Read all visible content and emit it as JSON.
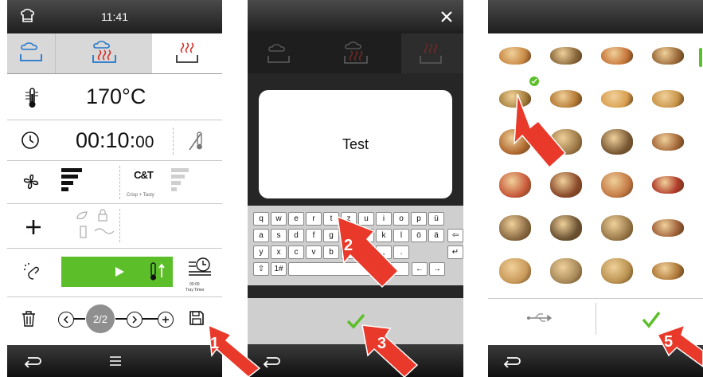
{
  "screen1": {
    "time": "11:41",
    "temperature": "170°C",
    "duration_main": "00:10:",
    "duration_seconds": "00",
    "crisp_label": "Crisp + Tasty",
    "crisp_logo": "C&T",
    "step_indicator": "2/2",
    "icons": [
      "chef-hat-icon",
      "steam-icon",
      "combi-icon",
      "dry-heat-icon",
      "thermometer-icon",
      "clock-icon",
      "core-probe-icon",
      "fan-icon",
      "plus-icon",
      "spray-icon",
      "play-icon",
      "timer-icon",
      "trash-icon",
      "prev-step-icon",
      "next-step-icon",
      "add-step-icon",
      "save-icon",
      "back-icon",
      "menu-icon"
    ]
  },
  "screen2": {
    "name_value": "Test",
    "keyboard_rows": [
      [
        "q",
        "w",
        "e",
        "r",
        "t",
        "z",
        "u",
        "i",
        "o",
        "p",
        "ü"
      ],
      [
        "a",
        "s",
        "d",
        "f",
        "g",
        "h",
        "j",
        "k",
        "l",
        "ö",
        "ä"
      ],
      [
        "y",
        "x",
        "c",
        "v",
        "b",
        "n",
        "m",
        ",",
        "."
      ]
    ],
    "symbols_key": "1#",
    "timer_under_label": "00:00",
    "timer_sub_label": "Tray Timer"
  },
  "callouts": [
    "1",
    "2",
    "3",
    "4",
    "5"
  ],
  "colors": {
    "accent_green": "#5cbf2a",
    "arrow_red": "#e8392a",
    "topbar": "#2a2a2a",
    "tab_bg": "#e6e6e6"
  }
}
